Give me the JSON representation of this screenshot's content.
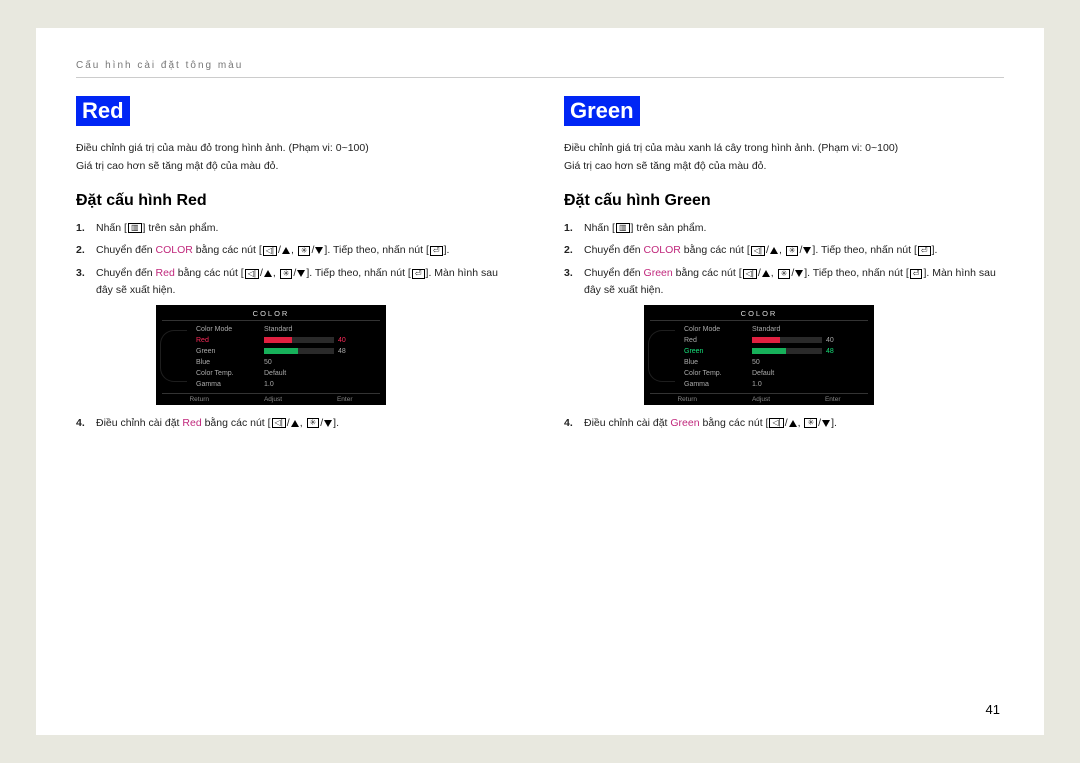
{
  "breadcrumb": "Cấu hình cài đặt tông màu",
  "page_number": "41",
  "icons": {
    "slash": "/",
    "comma": ","
  },
  "step_common": {
    "s1_a": "Nhấn [",
    "s1_b": "] trên sản phẩm.",
    "s2_a": "Chuyển đến ",
    "s2_kw": "COLOR",
    "s2_b": " bằng các nút [",
    "s2_c": "]. Tiếp theo, nhấn nút [",
    "s2_d": "].",
    "s3_a": "Chuyển đến ",
    "s3_b": " bằng các nút [",
    "s3_c": "]. Tiếp theo, nhấn nút [",
    "s3_d": "]. Màn hình sau đây sẽ xuất hiện.",
    "s4_a": "Điều chỉnh cài đặt ",
    "s4_b": " bằng các nút [",
    "s4_c": "]."
  },
  "left": {
    "title": "Red",
    "desc1": "Điều chỉnh giá trị của màu đỏ trong hình ảnh. (Phạm vi: 0~100)",
    "desc2": "Giá trị cao hơn sẽ tăng mật độ của màu đỏ.",
    "subtitle": "Đặt cấu hình Red",
    "kw": "Red"
  },
  "right": {
    "title": "Green",
    "desc1": "Điều chỉnh giá trị của màu xanh lá cây trong hình ảnh. (Phạm vi: 0~100)",
    "desc2": "Giá trị cao hơn sẽ tăng mật độ của màu đỏ.",
    "subtitle": "Đặt cấu hình Green",
    "kw": "Green"
  },
  "osd": {
    "header": "COLOR",
    "rows": [
      {
        "label": "Color Mode",
        "value": "Standard"
      },
      {
        "label": "Red",
        "value": "40",
        "bar": 40,
        "color": "#e02040"
      },
      {
        "label": "Green",
        "value": "48",
        "bar": 48,
        "color": "#17b05a"
      },
      {
        "label": "Blue",
        "value": "50"
      },
      {
        "label": "Color Temp.",
        "value": "Default"
      },
      {
        "label": "Gamma",
        "value": "1.0"
      }
    ],
    "foot": [
      "Return",
      "Adjust",
      "Enter"
    ],
    "left_highlight": "Red",
    "right_highlight": "Green"
  }
}
